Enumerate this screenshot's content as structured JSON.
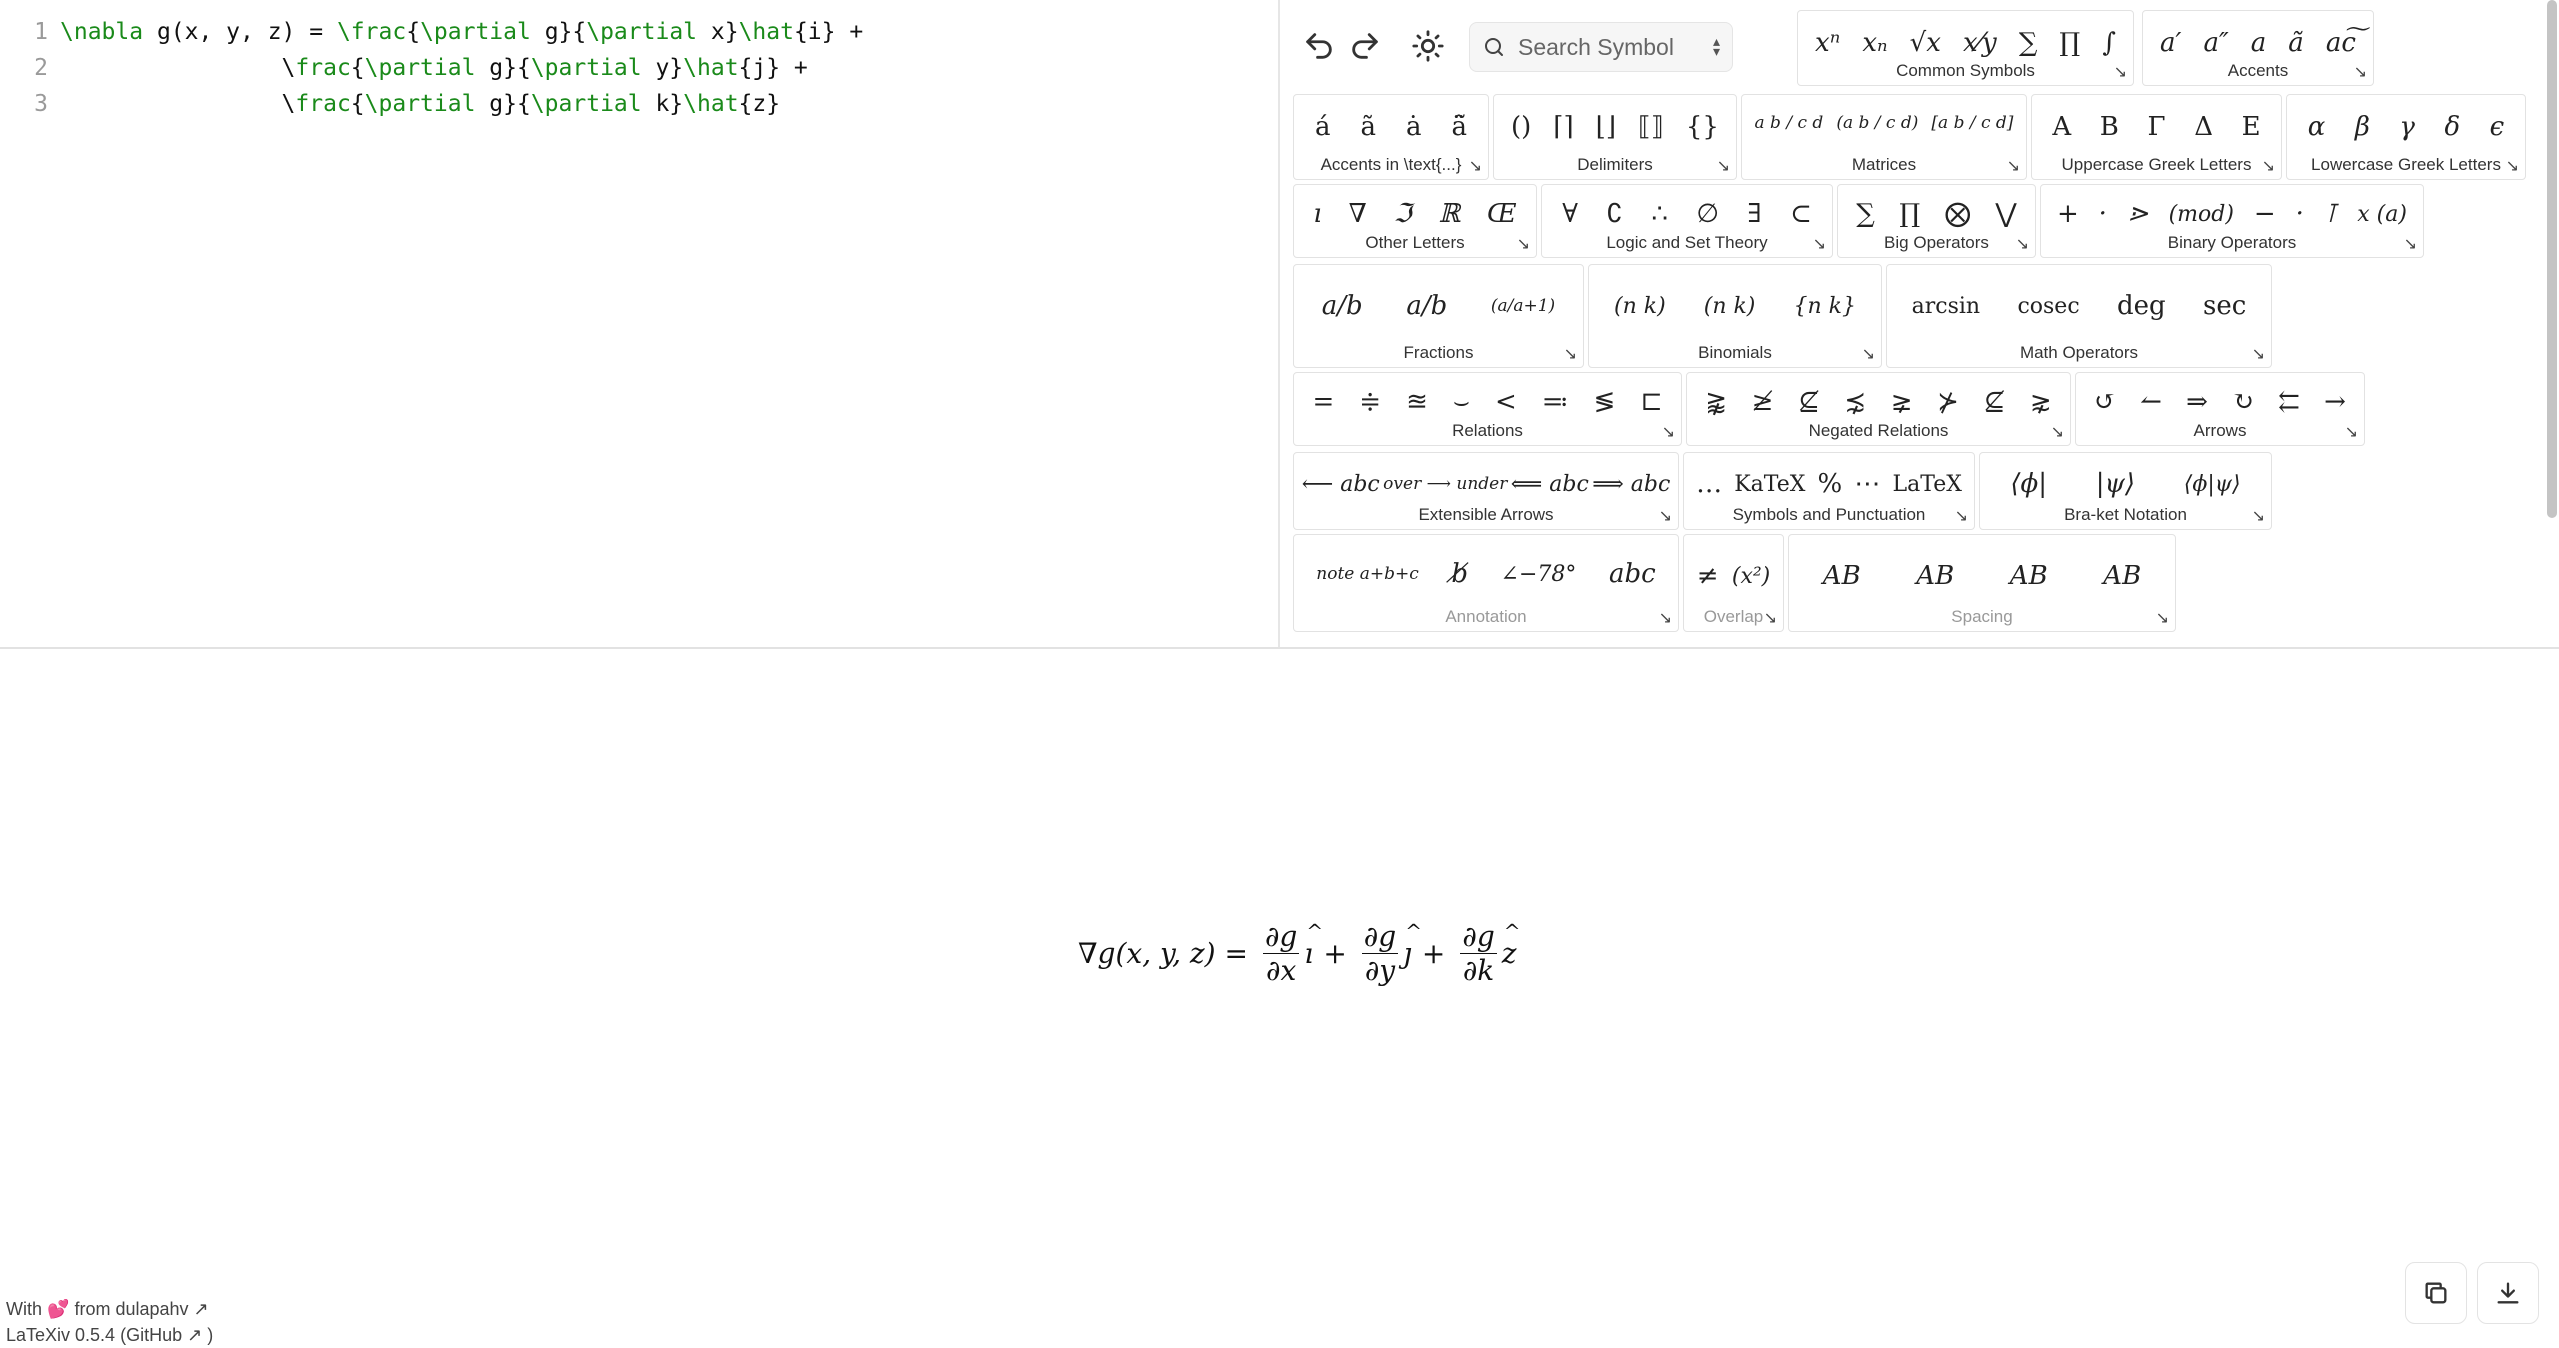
{
  "editor": {
    "lines": [
      {
        "n": "1",
        "tokens": [
          {
            "c": "cmd",
            "t": "\\nabla "
          },
          {
            "c": "txt",
            "t": "g(x, y, z) = "
          },
          {
            "c": "cmd",
            "t": "\\frac"
          },
          {
            "c": "txt",
            "t": "{"
          },
          {
            "c": "cmd",
            "t": "\\partial "
          },
          {
            "c": "txt",
            "t": "g}{"
          },
          {
            "c": "cmd",
            "t": "\\partial "
          },
          {
            "c": "txt",
            "t": "x}"
          },
          {
            "c": "cmd",
            "t": "\\hat"
          },
          {
            "c": "txt",
            "t": "{i} +"
          }
        ]
      },
      {
        "n": "2",
        "tokens": [
          {
            "c": "txt",
            "t": "                \\"
          },
          {
            "c": "cmd",
            "t": "frac"
          },
          {
            "c": "txt",
            "t": "{"
          },
          {
            "c": "cmd",
            "t": "\\partial "
          },
          {
            "c": "txt",
            "t": "g}{"
          },
          {
            "c": "cmd",
            "t": "\\partial "
          },
          {
            "c": "txt",
            "t": "y}"
          },
          {
            "c": "cmd",
            "t": "\\hat"
          },
          {
            "c": "txt",
            "t": "{j} +"
          }
        ]
      },
      {
        "n": "3",
        "tokens": [
          {
            "c": "txt",
            "t": "                \\"
          },
          {
            "c": "cmd",
            "t": "frac"
          },
          {
            "c": "txt",
            "t": "{"
          },
          {
            "c": "cmd",
            "t": "\\partial "
          },
          {
            "c": "txt",
            "t": "g}{"
          },
          {
            "c": "cmd",
            "t": "\\partial "
          },
          {
            "c": "txt",
            "t": "k}"
          },
          {
            "c": "cmd",
            "t": "\\hat"
          },
          {
            "c": "txt",
            "t": "{z}"
          }
        ]
      }
    ]
  },
  "toolbar": {
    "undo_icon": "undo-icon",
    "redo_icon": "redo-icon",
    "theme_icon": "sun-icon",
    "search_placeholder": "Search Symbol"
  },
  "groups": [
    {
      "id": "common-symbols",
      "label": "Common Symbols",
      "symbols": [
        "xⁿ",
        "xₙ",
        "√x",
        "x⁄y",
        "∑",
        "∏",
        "∫"
      ]
    },
    {
      "id": "accents",
      "label": "Accents",
      "symbols": [
        "a′",
        "a″",
        "a",
        "ã",
        "ac͠"
      ]
    },
    {
      "id": "accents-text",
      "label": "Accents in \\text{...}",
      "symbols": [
        "á",
        "ã",
        "ȧ",
        "ä̃"
      ]
    },
    {
      "id": "delimiters",
      "label": "Delimiters",
      "symbols": [
        "()",
        "⌈⌉",
        "⌊⌋",
        "⟦⟧",
        "{}"
      ]
    },
    {
      "id": "matrices",
      "label": "Matrices",
      "symbols": [
        "a b / c d",
        "(a b / c d)",
        "[a b / c d]"
      ]
    },
    {
      "id": "uppercase-greek",
      "label": "Uppercase Greek Letters",
      "symbols": [
        "A",
        "B",
        "Γ",
        "Δ",
        "E"
      ]
    },
    {
      "id": "lowercase-greek",
      "label": "Lowercase Greek Letters",
      "symbols": [
        "α",
        "β",
        "γ",
        "δ",
        "ϵ"
      ]
    },
    {
      "id": "other-letters",
      "label": "Other Letters",
      "symbols": [
        "ı",
        "∇",
        "ℑ",
        "ℝ",
        "Œ"
      ]
    },
    {
      "id": "logic-set",
      "label": "Logic and Set Theory",
      "symbols": [
        "∀",
        "∁",
        "∴",
        "∅",
        "∃",
        "⊂"
      ]
    },
    {
      "id": "big-operators",
      "label": "Big Operators",
      "symbols": [
        "∑",
        "∏",
        "⨂",
        "⋁"
      ]
    },
    {
      "id": "binary-operators",
      "label": "Binary Operators",
      "symbols": [
        "+",
        "·",
        "⋗",
        "(mod)",
        "−",
        "·",
        "⊺",
        "x (a)"
      ]
    },
    {
      "id": "fractions",
      "label": "Fractions",
      "symbols": [
        "a/b",
        "a/b",
        "(a/a+1)"
      ]
    },
    {
      "id": "binomials",
      "label": "Binomials",
      "symbols": [
        "(n k)",
        "(n k)",
        "{n k}"
      ]
    },
    {
      "id": "math-operators",
      "label": "Math Operators",
      "symbols": [
        "arcsin",
        "cosec",
        "deg",
        "sec"
      ]
    },
    {
      "id": "relations",
      "label": "Relations",
      "symbols": [
        "=",
        "≑",
        "≊",
        "⌣",
        "<",
        "≕",
        "≶",
        "⊏"
      ]
    },
    {
      "id": "negated-relations",
      "label": "Negated Relations",
      "symbols": [
        "⪊",
        "≱",
        "⊈",
        "⋨",
        "⪈",
        "⊁",
        "⊈",
        "⋧"
      ]
    },
    {
      "id": "arrows",
      "label": "Arrows",
      "symbols": [
        "↺",
        "↼",
        "⇒",
        "↻",
        "⇇",
        "→"
      ]
    },
    {
      "id": "extensible-arrows",
      "label": "Extensible Arrows",
      "symbols": [
        "⟵ abc",
        "over ⟶ under",
        "⟸ abc",
        "⟹ abc"
      ]
    },
    {
      "id": "symbols-punctuation",
      "label": "Symbols and Punctuation",
      "symbols": [
        "…",
        "KaTeX",
        "%",
        "⋯",
        "LaTeX"
      ]
    },
    {
      "id": "bra-ket",
      "label": "Bra-ket Notation",
      "symbols": [
        "⟨ϕ|",
        "|ψ⟩",
        "⟨ϕ|ψ⟩"
      ]
    },
    {
      "id": "annotation",
      "label": "Annotation",
      "symbols": [
        "note a+b+c",
        "b̸",
        "∠−78°",
        "abc"
      ]
    },
    {
      "id": "overlap",
      "label": "Overlap",
      "symbols": [
        "≠",
        "(x²)"
      ]
    },
    {
      "id": "spacing",
      "label": "Spacing",
      "symbols": [
        "AB",
        "AB",
        "AB",
        "AB"
      ]
    }
  ],
  "output": {
    "lhs": "∇g(x, y, z) =",
    "t1_num": "∂g",
    "t1_den": "∂x",
    "t1_vec": "ı",
    "plus1": "+",
    "t2_num": "∂g",
    "t2_den": "∂y",
    "t2_vec": "ȷ",
    "plus2": "+",
    "t3_num": "∂g",
    "t3_den": "∂k",
    "t3_vec": "z"
  },
  "footer": {
    "with_text": "With",
    "heart": "💕",
    "from_text": "from dulapahv",
    "version_text": "LaTeXiv 0.5.4 (GitHub",
    "version_close": ")"
  },
  "colors": {
    "command": "#1a8a1a",
    "text": "#111111",
    "line_number": "#9a9a9a",
    "border": "#e2e2e2"
  }
}
